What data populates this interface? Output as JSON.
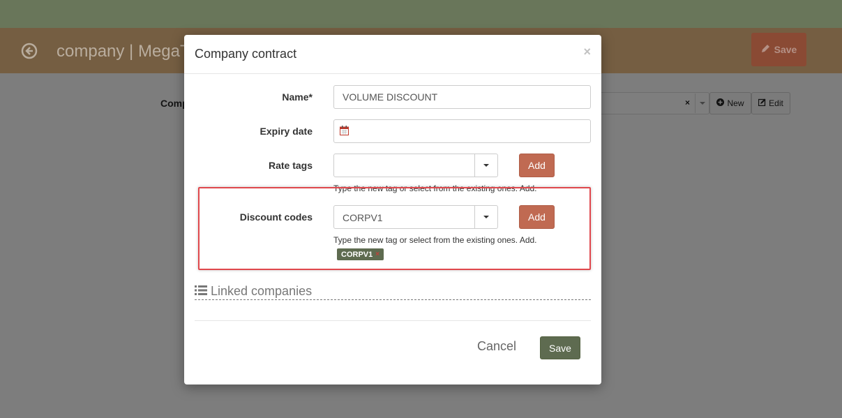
{
  "page": {
    "title": "company | MegaT",
    "save_label": "Save",
    "company_label": "Comp",
    "company_clear": "×",
    "new_label": "New",
    "edit_label": "Edit"
  },
  "modal": {
    "title": "Company contract",
    "close": "×",
    "fields": {
      "name": {
        "label": "Name*",
        "value": "VOLUME DISCOUNT"
      },
      "expiry": {
        "label": "Expiry date",
        "value": ""
      },
      "rate_tags": {
        "label": "Rate tags",
        "value": "",
        "add_label": "Add",
        "help": "Type the new tag or select from the existing ones. Add."
      },
      "discount_codes": {
        "label": "Discount codes",
        "value": "CORPV1",
        "add_label": "Add",
        "help": "Type the new tag or select from the existing ones. Add.",
        "tags": [
          "CORPV1"
        ],
        "tag_remove": "×"
      }
    },
    "linked_companies": "Linked companies",
    "cancel_label": "Cancel",
    "save_label": "Save"
  },
  "colors": {
    "accent_add": "#c06a52",
    "accent_save": "#5e6b50",
    "highlight": "#e0474c"
  }
}
